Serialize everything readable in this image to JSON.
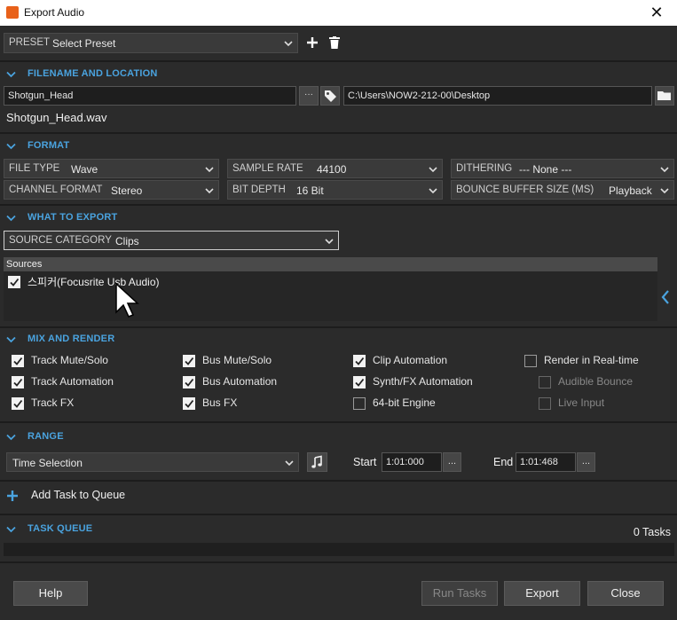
{
  "window": {
    "title": "Export Audio",
    "close_glyph": "✕"
  },
  "preset": {
    "label": "PRESET",
    "value": "Select Preset"
  },
  "sections": {
    "filename": "FILENAME AND LOCATION",
    "format": "FORMAT",
    "what_to_export": "WHAT TO EXPORT",
    "mix_and_render": "MIX AND RENDER",
    "range": "RANGE",
    "task_queue": "TASK QUEUE"
  },
  "filename": {
    "name": "Shotgun_Head",
    "path": "C:\\Users\\NOW2-212-00\\Desktop",
    "result": "Shotgun_Head.wav",
    "more_button": "···"
  },
  "format": {
    "file_type": {
      "label": "FILE TYPE",
      "value": "Wave"
    },
    "sample_rate": {
      "label": "SAMPLE RATE",
      "value": "44100"
    },
    "dithering": {
      "label": "DITHERING",
      "value": "--- None ---"
    },
    "channel_format": {
      "label": "CHANNEL FORMAT",
      "value": "Stereo"
    },
    "bit_depth": {
      "label": "BIT DEPTH",
      "value": "16 Bit"
    },
    "bounce_buffer": {
      "label": "BOUNCE BUFFER SIZE (MS)",
      "value": "Playback"
    }
  },
  "export": {
    "source_category": {
      "label": "SOURCE CATEGORY",
      "value": "Clips"
    },
    "sources_header": "Sources",
    "sources": [
      {
        "label": "스피커(Focusrite Usb Audio)",
        "checked": true
      }
    ]
  },
  "mix": {
    "col1": [
      {
        "label": "Track Mute/Solo",
        "checked": true,
        "enabled": true
      },
      {
        "label": "Track Automation",
        "checked": true,
        "enabled": true
      },
      {
        "label": "Track FX",
        "checked": true,
        "enabled": true
      }
    ],
    "col2": [
      {
        "label": "Bus Mute/Solo",
        "checked": true,
        "enabled": true
      },
      {
        "label": "Bus Automation",
        "checked": true,
        "enabled": true
      },
      {
        "label": "Bus FX",
        "checked": true,
        "enabled": true
      }
    ],
    "col3": [
      {
        "label": "Clip Automation",
        "checked": true,
        "enabled": true
      },
      {
        "label": "Synth/FX Automation",
        "checked": true,
        "enabled": true
      },
      {
        "label": "64-bit Engine",
        "checked": false,
        "enabled": true
      }
    ],
    "col4": [
      {
        "label": "Render in Real-time",
        "checked": false,
        "enabled": true
      },
      {
        "label": "Audible Bounce",
        "checked": false,
        "enabled": false
      },
      {
        "label": "Live Input",
        "checked": false,
        "enabled": false
      }
    ]
  },
  "range": {
    "mode": "Time Selection",
    "start_label": "Start",
    "start_value": "1:01:000",
    "end_label": "End",
    "end_value": "1:01:468",
    "dots": "..."
  },
  "queue": {
    "add_task": "Add Task to Queue",
    "count": "0 Tasks"
  },
  "buttons": {
    "help": "Help",
    "run_tasks": "Run Tasks",
    "export": "Export",
    "close": "Close"
  },
  "colors": {
    "accent": "#4aa3df",
    "background": "#2b2b2b",
    "app_icon": "#e8611a"
  }
}
